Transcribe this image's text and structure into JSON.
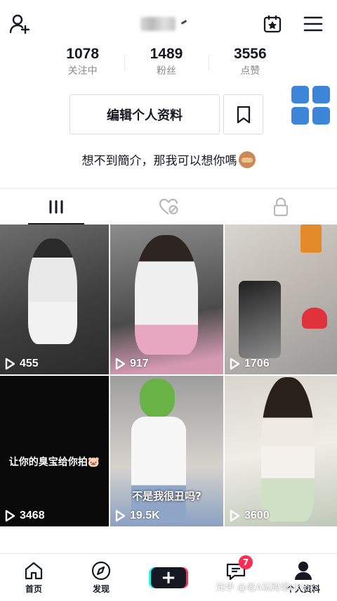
{
  "stats": [
    {
      "value": "1078",
      "label": "关注中"
    },
    {
      "value": "1489",
      "label": "粉丝"
    },
    {
      "value": "3556",
      "label": "点赞"
    }
  ],
  "actions": {
    "edit_profile": "编辑个人资料"
  },
  "bio": "想不到簡介，那我可以想你嗎",
  "videos": [
    {
      "views": "455",
      "caption": ""
    },
    {
      "views": "917",
      "caption": ""
    },
    {
      "views": "1706",
      "caption": ""
    },
    {
      "views": "3468",
      "caption": "让你的臭宝给你拍🐷"
    },
    {
      "views": "19.5K",
      "caption": "不是我很丑吗?"
    },
    {
      "views": "3600",
      "caption": ""
    }
  ],
  "nav": {
    "home": "首页",
    "discover": "发现",
    "inbox_badge": "7",
    "profile": "个人资料"
  },
  "watermark": "知乎 @老A玩跨境tiktok",
  "colors": {
    "accent_blue": "#3d85d8",
    "badge_red": "#fe2c55",
    "cyan": "#25f4ee"
  }
}
